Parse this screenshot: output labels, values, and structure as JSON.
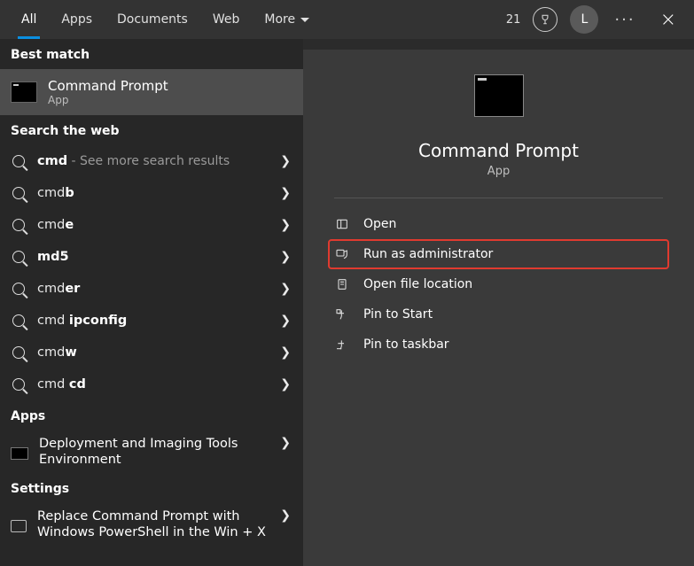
{
  "topbar": {
    "tabs": {
      "all": "All",
      "apps": "Apps",
      "documents": "Documents",
      "web": "Web",
      "more": "More"
    },
    "points": "21",
    "avatar_initial": "L"
  },
  "left": {
    "best_match_header": "Best match",
    "best_match": {
      "title": "Command Prompt",
      "sub": "App"
    },
    "search_web_header": "Search the web",
    "web_rows": [
      {
        "pre": "",
        "strong": "cmd",
        "post": "",
        "hint": " - See more search results"
      },
      {
        "pre": "cmd",
        "strong": "b",
        "post": ""
      },
      {
        "pre": "cmd",
        "strong": "e",
        "post": ""
      },
      {
        "pre": "",
        "strong": "md5",
        "post": ""
      },
      {
        "pre": "cmd",
        "strong": "er",
        "post": ""
      },
      {
        "pre": "cmd ",
        "strong": "ipconfig",
        "post": ""
      },
      {
        "pre": "cmd",
        "strong": "w",
        "post": ""
      },
      {
        "pre": "cmd ",
        "strong": "cd",
        "post": ""
      }
    ],
    "apps_header": "Apps",
    "app_row": "Deployment and Imaging Tools Environment",
    "settings_header": "Settings",
    "settings_row": "Replace Command Prompt with Windows PowerShell in the Win + X"
  },
  "right": {
    "title": "Command Prompt",
    "sub": "App",
    "actions": {
      "open": "Open",
      "run_admin": "Run as administrator",
      "open_loc": "Open file location",
      "pin_start": "Pin to Start",
      "pin_taskbar": "Pin to taskbar"
    }
  }
}
